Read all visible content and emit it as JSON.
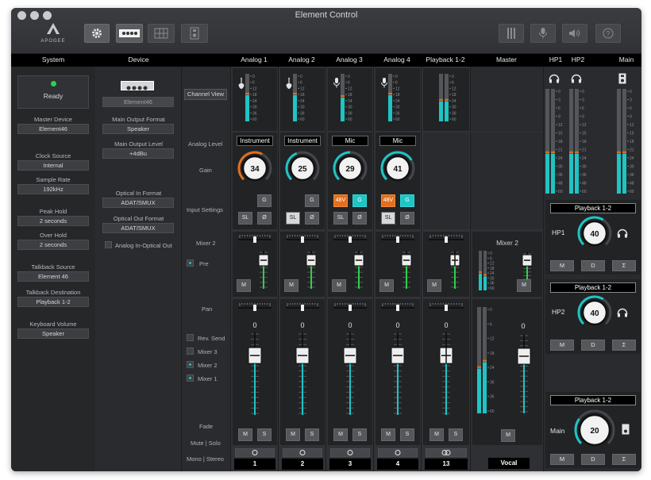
{
  "window": {
    "title": "Element Control",
    "brand": "APOGEE"
  },
  "headers": {
    "system": "System",
    "device": "Device",
    "master": "Master",
    "hp1": "HP1",
    "hp2": "HP2",
    "main": "Main"
  },
  "system": {
    "status": "Ready",
    "status_color": "#2ed04b",
    "fields": [
      {
        "label": "Master Device",
        "value": "Element46"
      },
      {
        "label": "Clock Source",
        "value": "Internal"
      },
      {
        "label": "Sample Rate",
        "value": "192kHz"
      },
      {
        "label": "Peak Hold",
        "value": "2 seconds"
      },
      {
        "label": "Over Hold",
        "value": "2 seconds"
      },
      {
        "label": "Talkback Source",
        "value": "Element 46"
      },
      {
        "label": "Talkback Destination",
        "value": "Playback 1-2"
      },
      {
        "label": "Keyboard Volume",
        "value": "Speaker"
      }
    ]
  },
  "device": {
    "name": "Element46",
    "fields": [
      {
        "label": "Main Output Format",
        "value": "Speaker"
      },
      {
        "label": "Main Output Level",
        "value": "+4dBu"
      },
      {
        "label": "Optical In Format",
        "value": "ADAT/SMUX"
      },
      {
        "label": "Optical Out Format",
        "value": "ADAT/SMUX"
      }
    ],
    "checkbox": "Analog In-Optical Out"
  },
  "side_labels": {
    "channel_view": "Channel View",
    "analog_level": "Analog Level",
    "gain": "Gain",
    "input_settings": "Input Settings",
    "mixer2": "Mixer 2",
    "pre": "Pre",
    "pan": "Pan",
    "rev_send": "Rev. Send",
    "mixer3": "Mixer 3",
    "mixer2b": "Mixer 2",
    "mixer1": "Mixer 1",
    "fade": "Fade",
    "mute_solo": "Mute | Solo",
    "mono_stereo": "Mono | Stereo"
  },
  "meter_scale": [
    "0",
    "6",
    "12",
    "18",
    "24",
    "30",
    "36",
    "60"
  ],
  "hp_meter_scale": [
    "0",
    "3",
    "6",
    "9",
    "12",
    "15",
    "18",
    "21",
    "24",
    "30",
    "36",
    "48",
    "60"
  ],
  "labels": {
    "mute": "M",
    "solo": "S",
    "dim": "D",
    "sum": "Σ",
    "g": "G",
    "sl": "SL",
    "phase": "Ø",
    "v48": "48V",
    "mixer2_title": "Mixer 2"
  },
  "channels": [
    {
      "name": "Analog 1",
      "icon": "guitar-icon",
      "input": "Instrument",
      "gain": "34",
      "gain_frac": 0.6,
      "gain_color": "#e07020",
      "has48v": false,
      "sl_on": false,
      "g_on": false,
      "num": "1",
      "fader_val": "0",
      "meter": 0.55
    },
    {
      "name": "Analog 2",
      "icon": "guitar-icon",
      "input": "Instrument",
      "gain": "25",
      "gain_frac": 0.42,
      "gain_color": "#1fc4c4",
      "has48v": false,
      "sl_on": true,
      "g_on": false,
      "num": "2",
      "fader_val": "0",
      "meter": 0.55
    },
    {
      "name": "Analog 3",
      "icon": "mic-icon",
      "input": "Mic",
      "gain": "29",
      "gain_frac": 0.5,
      "gain_color": "#1fc4c4",
      "has48v": true,
      "sl_on": false,
      "g_on": true,
      "num": "3",
      "fader_val": "0",
      "meter": 0.5
    },
    {
      "name": "Analog 4",
      "icon": "mic-icon",
      "input": "Mic",
      "gain": "41",
      "gain_frac": 0.72,
      "gain_color": "#1fc4c4",
      "has48v": true,
      "sl_on": true,
      "g_on": true,
      "num": "4",
      "fader_val": "0",
      "meter": 0.55
    },
    {
      "name": "Playback 1-2",
      "icon": "",
      "input": "",
      "gain": "",
      "num": "13",
      "fader_val": "0",
      "meter": 0.42
    }
  ],
  "master": {
    "name": "Vocal",
    "mixer_title": "Mixer 2",
    "fader_val": "0"
  },
  "outputs": [
    {
      "label": "HP1",
      "source": "Playback 1-2",
      "value": "40",
      "frac": 0.62
    },
    {
      "label": "HP2",
      "source": "Playback 1-2",
      "value": "40",
      "frac": 0.62
    },
    {
      "label": "Main",
      "source": "Playback 1-2",
      "value": "20",
      "frac": 0.3
    }
  ],
  "colors": {
    "accent": "#1fc4c4",
    "orange": "#e07020",
    "meter_bg": "#54565a"
  }
}
